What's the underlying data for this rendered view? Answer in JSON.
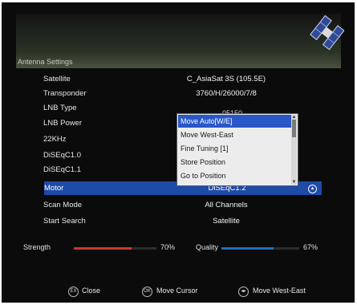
{
  "panel": {
    "title": "Antenna Settings"
  },
  "settings": [
    {
      "label": "Satellite",
      "value": "C_AsiaSat 3S  (105.5E)"
    },
    {
      "label": "Transponder",
      "value": "3760/H/26000/7/8"
    },
    {
      "label": "LNB Type",
      "value": ""
    },
    {
      "label": "LNB Power",
      "value": ""
    },
    {
      "label": "22KHz",
      "value": ""
    },
    {
      "label": "DiSEqC1.0",
      "value": ""
    },
    {
      "label": "DiSEqC1.1",
      "value": ""
    },
    {
      "label": "Motor",
      "value": "DiSEqC1.2"
    },
    {
      "label": "Scan Mode",
      "value": "All Channels"
    },
    {
      "label": "Start Search",
      "value": "Satellite"
    }
  ],
  "lnb_type_partial": "05150",
  "dropdown": {
    "options": [
      "Move Auto[W/E]",
      "Move West-East",
      "Fine Tuning [1]",
      "Store Position",
      "Go to Position"
    ],
    "selected_index": 0
  },
  "signal": {
    "strength_label": "Strength",
    "strength_pct": "70%",
    "strength_value": 0.7,
    "quality_label": "Quality",
    "quality_pct": "67%",
    "quality_value": 0.67
  },
  "footer": [
    {
      "icon": "exit-icon",
      "label": "Close"
    },
    {
      "icon": "ok-icon",
      "label": "Move Cursor"
    },
    {
      "icon": "left-right-icon",
      "label": "Move West-East"
    }
  ],
  "colors": {
    "selection": "#1e4aa8",
    "strength": "#c83a2a",
    "quality": "#1f6fc4",
    "dropdown_selection": "#2a57c8"
  }
}
